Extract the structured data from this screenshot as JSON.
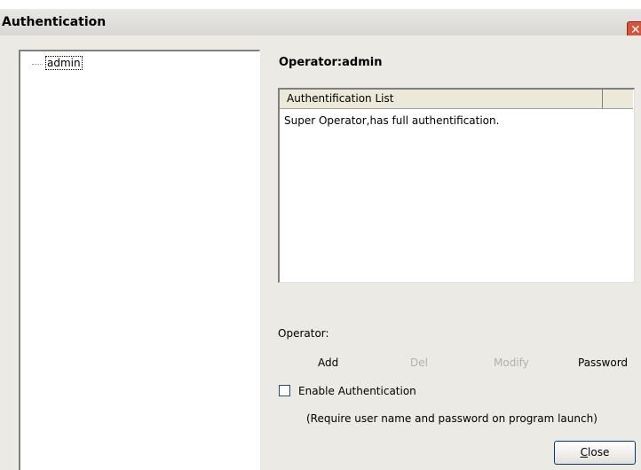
{
  "window": {
    "title": "Authentication",
    "close_glyph": "✕"
  },
  "tree": {
    "items": [
      {
        "label": "admin"
      }
    ]
  },
  "operator_title": "Operator:admin",
  "list": {
    "columns": [
      "Authentification List",
      ""
    ],
    "rows": [
      "Super Operator,has full authentification."
    ]
  },
  "operator_label": "Operator:",
  "actions": {
    "add": "Add",
    "del": "Del",
    "modify": "Modify",
    "password": "Password"
  },
  "enable_auth": {
    "label": "Enable Authentication",
    "checked": false
  },
  "hint": "(Require user name and password on program launch)",
  "close_button": {
    "mnemonic": "C",
    "rest": "lose"
  }
}
